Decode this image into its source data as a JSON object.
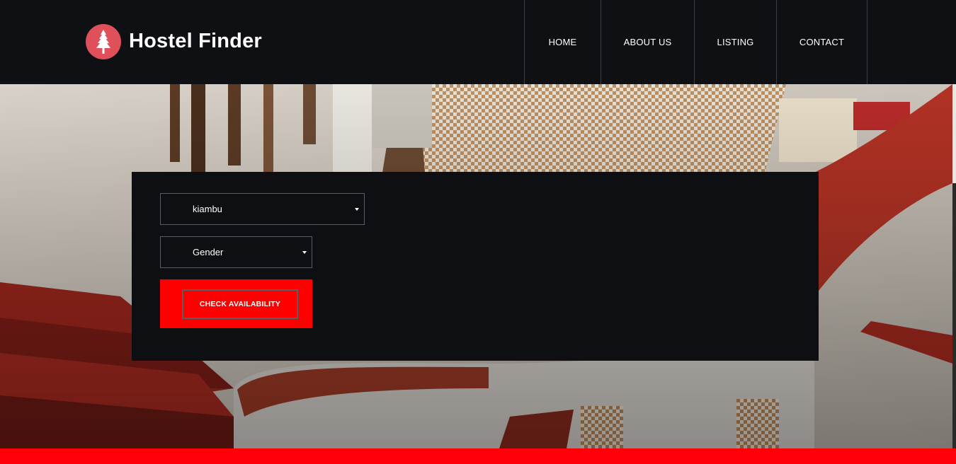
{
  "brand": {
    "name": "Hostel Finder",
    "logo_icon": "pine-tree-icon",
    "logo_color": "#e0505a"
  },
  "nav": {
    "items": [
      {
        "label": "HOME"
      },
      {
        "label": "ABOUT US"
      },
      {
        "label": "LISTING"
      },
      {
        "label": "CONTACT"
      }
    ]
  },
  "search": {
    "location": {
      "selected": "kiambu"
    },
    "gender": {
      "selected": "Gender"
    },
    "submit_label": "CHECK AVAILABILITY"
  },
  "colors": {
    "accent": "#ff0000",
    "header_bg": "#0e1013",
    "panel_bg": "#0d0f12"
  }
}
